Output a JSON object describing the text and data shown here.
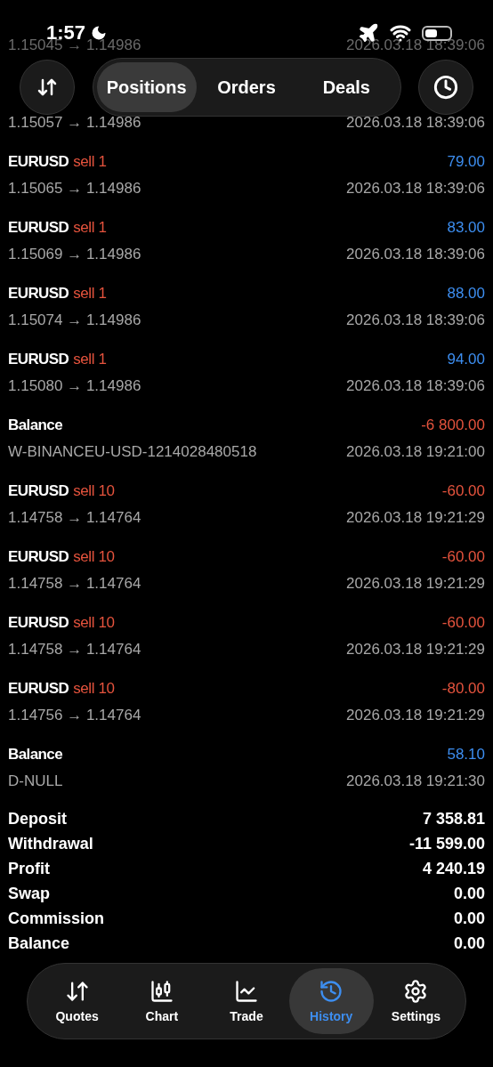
{
  "status_bar": {
    "time": "1:57"
  },
  "segments": [
    {
      "label": "Positions",
      "selected": true
    },
    {
      "label": "Orders",
      "selected": false
    },
    {
      "label": "Deals",
      "selected": false
    }
  ],
  "deals": [
    {
      "faded": true,
      "prices": "1.15045 → 1.14986",
      "time": "2026.03.18 18:39:06"
    },
    {
      "faded": false,
      "prices": "1.15057 → 1.14986",
      "time": "2026.03.18 18:39:06"
    },
    {
      "faded": false,
      "symbol": "EURUSD",
      "side": "sell 1",
      "value": "79.00",
      "color": "#3d8ef0",
      "prices": "1.15065 → 1.14986",
      "time": "2026.03.18 18:39:06"
    },
    {
      "faded": false,
      "symbol": "EURUSD",
      "side": "sell 1",
      "value": "83.00",
      "color": "#3d8ef0",
      "prices": "1.15069 → 1.14986",
      "time": "2026.03.18 18:39:06"
    },
    {
      "faded": false,
      "symbol": "EURUSD",
      "side": "sell 1",
      "value": "88.00",
      "color": "#3d8ef0",
      "prices": "1.15074 → 1.14986",
      "time": "2026.03.18 18:39:06"
    },
    {
      "faded": false,
      "symbol": "EURUSD",
      "side": "sell 1",
      "value": "94.00",
      "color": "#3d8ef0",
      "prices": "1.15080 → 1.14986",
      "time": "2026.03.18 18:39:06"
    },
    {
      "faded": false,
      "symbol": "Balance",
      "value": "-6 800.00",
      "color": "#e5533d",
      "prices": "W-BINANCEU-USD-1214028480518",
      "time": "2026.03.18 19:21:00"
    },
    {
      "faded": false,
      "symbol": "EURUSD",
      "side": "sell 10",
      "value": "-60.00",
      "color": "#e5533d",
      "prices": "1.14758 → 1.14764",
      "time": "2026.03.18 19:21:29"
    },
    {
      "faded": false,
      "symbol": "EURUSD",
      "side": "sell 10",
      "value": "-60.00",
      "color": "#e5533d",
      "prices": "1.14758 → 1.14764",
      "time": "2026.03.18 19:21:29"
    },
    {
      "faded": false,
      "symbol": "EURUSD",
      "side": "sell 10",
      "value": "-60.00",
      "color": "#e5533d",
      "prices": "1.14758 → 1.14764",
      "time": "2026.03.18 19:21:29"
    },
    {
      "faded": false,
      "symbol": "EURUSD",
      "side": "sell 10",
      "value": "-80.00",
      "color": "#e5533d",
      "prices": "1.14756 → 1.14764",
      "time": "2026.03.18 19:21:29"
    },
    {
      "faded": false,
      "symbol": "Balance",
      "value": "58.10",
      "color": "#3d8ef0",
      "prices": "D-NULL",
      "time": "2026.03.18 19:21:30"
    }
  ],
  "summary": [
    {
      "label": "Deposit",
      "value": "7 358.81"
    },
    {
      "label": "Withdrawal",
      "value": "-11 599.00"
    },
    {
      "label": "Profit",
      "value": "4 240.19"
    },
    {
      "label": "Swap",
      "value": "0.00"
    },
    {
      "label": "Commission",
      "value": "0.00"
    },
    {
      "label": "Balance",
      "value": "0.00"
    }
  ],
  "tab_bar": [
    {
      "kind": "quotes",
      "label": "Quotes",
      "selected": false
    },
    {
      "kind": "chart",
      "label": "Chart",
      "selected": false
    },
    {
      "kind": "trade",
      "label": "Trade",
      "selected": false
    },
    {
      "kind": "history",
      "label": "History",
      "selected": true
    },
    {
      "kind": "settings",
      "label": "Settings",
      "selected": false
    }
  ]
}
